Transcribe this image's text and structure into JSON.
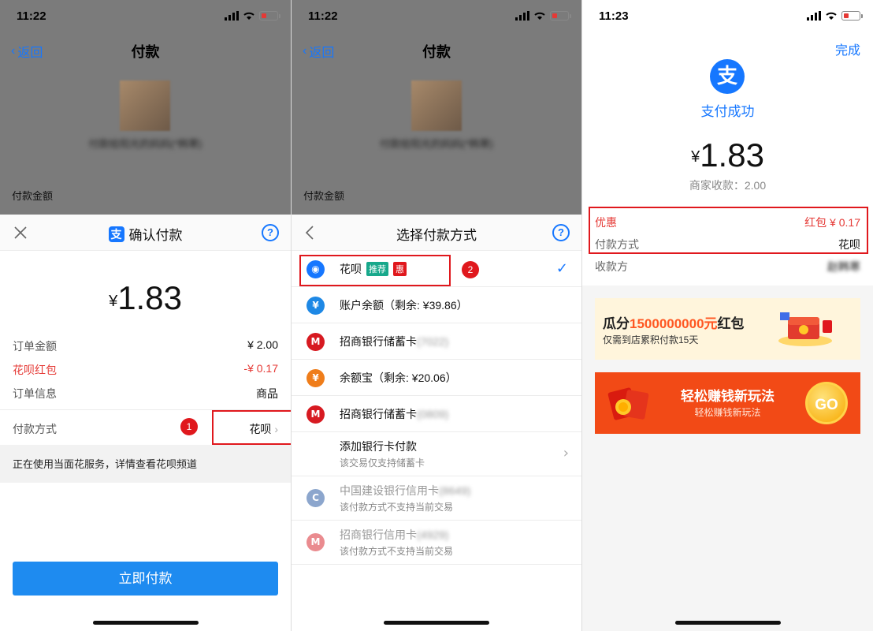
{
  "screen1": {
    "time": "11:22",
    "back_label": "返回",
    "nav_title": "付款",
    "payee_name": "付款给阳光的妈妈(*韩寒)",
    "amount_label": "付款金额",
    "sheet_title": "确认付款",
    "logo_glyph": "支",
    "help_glyph": "?",
    "yen": "¥",
    "amount": "1.83",
    "rows": [
      {
        "label": "订单金额",
        "value": "¥ 2.00",
        "red": false
      },
      {
        "label": "花呗红包",
        "value": "-¥ 0.17",
        "red": true
      },
      {
        "label": "订单信息",
        "value": "商品",
        "red": false
      }
    ],
    "pay_method_label": "付款方式",
    "pay_method_value": "花呗",
    "badge": "1",
    "notice": "正在使用当面花服务，详情查看花呗频道",
    "pay_button": "立即付款"
  },
  "screen2": {
    "time": "11:22",
    "back_label": "返回",
    "nav_title": "付款",
    "payee_name": "付款给阳光的妈妈(*韩寒)",
    "amount_label": "付款金额",
    "sheet_title": "选择付款方式",
    "help_glyph": "?",
    "badge": "2",
    "methods": [
      {
        "label": "花呗",
        "tag1": "推荐",
        "tag2": "惠",
        "icon": "huabei-icon",
        "glyph": "◉",
        "color": "#1677ff"
      },
      {
        "label": "账户余额（剩余: ¥39.86）",
        "icon": "balance-icon",
        "glyph": "¥",
        "color": "#1e88e5"
      },
      {
        "label": "招商银行储蓄卡",
        "tail": "(7022)",
        "icon": "cmb-icon",
        "glyph": "M",
        "color": "#d71a21"
      },
      {
        "label": "余额宝（剩余: ¥20.06）",
        "icon": "yuebao-icon",
        "glyph": "¥",
        "color": "#ef7d1a"
      },
      {
        "label": "招商银行储蓄卡",
        "tail": "(0809)",
        "icon": "cmb-icon",
        "glyph": "M",
        "color": "#d71a21"
      },
      {
        "label": "添加银行卡付款",
        "sub": "该交易仅支持储蓄卡",
        "icon": "add-card-icon"
      },
      {
        "label": "中国建设银行信用卡",
        "tail": "(8649)",
        "sub": "该付款方式不支持当前交易",
        "icon": "ccb-icon",
        "glyph": "C",
        "color": "#1b4f9c"
      },
      {
        "label": "招商银行信用卡",
        "tail": "(4929)",
        "sub": "该付款方式不支持当前交易",
        "icon": "cmb-icon",
        "glyph": "M",
        "color": "#d71a21"
      }
    ]
  },
  "screen3": {
    "time": "11:23",
    "done_label": "完成",
    "logo_glyph": "支",
    "success_text": "支付成功",
    "yen": "¥",
    "amount": "1.83",
    "merchant": "商家收款：2.00",
    "discount_label": "优惠",
    "discount_value": "红包 ¥ 0.17",
    "pay_method_label": "付款方式",
    "pay_method_value": "花呗",
    "payee_label": "收款方",
    "payee_value": "赵韩寒",
    "promo1": {
      "title_pre": "瓜分",
      "title_hot": "1500000000元",
      "title_post": "红包",
      "subtitle": "仅需到店累积付款15天"
    },
    "promo2": {
      "title": "轻松赚钱新玩法",
      "subtitle": "轻松赚钱新玩法",
      "go": "GO"
    }
  },
  "colors": {
    "accent": "#1677ff",
    "red": "#e0181d",
    "button": "#1e8bf0"
  }
}
